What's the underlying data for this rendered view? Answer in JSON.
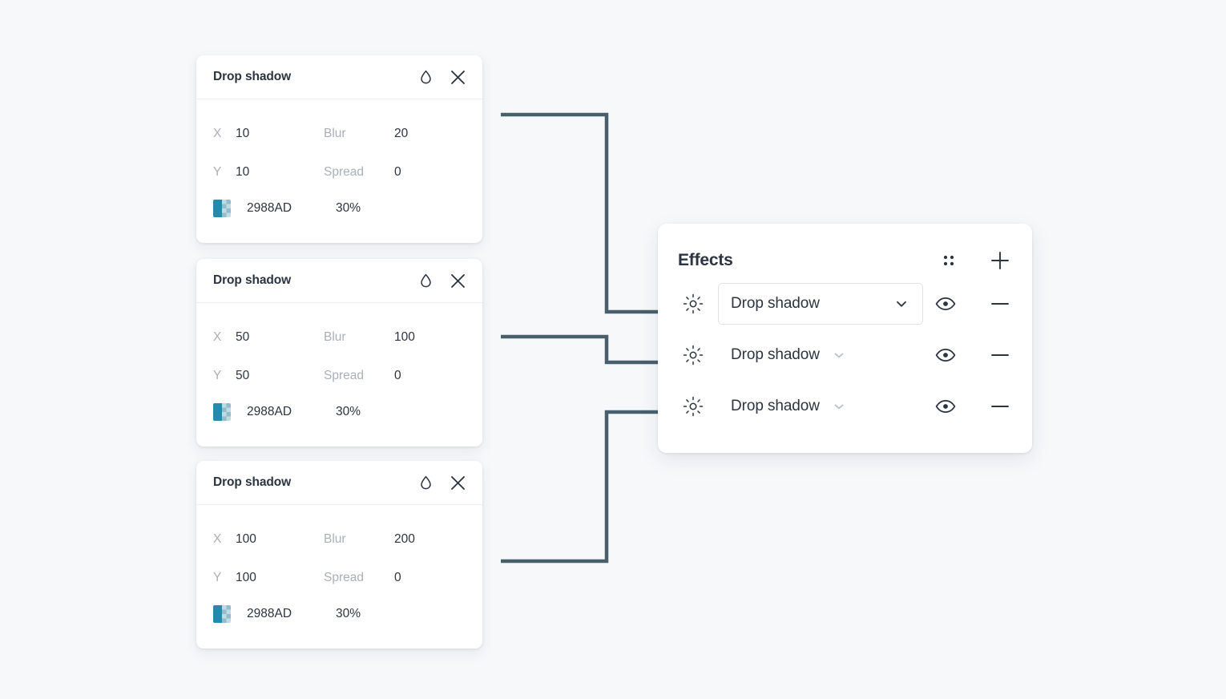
{
  "canvas": {
    "background_color": "#f6f8fa",
    "connector_color": "#47606c"
  },
  "shadow_cards": [
    {
      "title": "Drop shadow",
      "icons": {
        "droplet": "droplet-icon",
        "close": "close-icon"
      },
      "fields": {
        "x_label": "X",
        "x_value": "10",
        "y_label": "Y",
        "y_value": "10",
        "blur_label": "Blur",
        "blur_value": "20",
        "spread_label": "Spread",
        "spread_value": "0"
      },
      "color": {
        "hex": "2988AD",
        "swatch_color": "#2988AD",
        "opacity": "30%"
      }
    },
    {
      "title": "Drop shadow",
      "icons": {
        "droplet": "droplet-icon",
        "close": "close-icon"
      },
      "fields": {
        "x_label": "X",
        "x_value": "50",
        "y_label": "Y",
        "y_value": "50",
        "blur_label": "Blur",
        "blur_value": "100",
        "spread_label": "Spread",
        "spread_value": "0"
      },
      "color": {
        "hex": "2988AD",
        "swatch_color": "#2988AD",
        "opacity": "30%"
      }
    },
    {
      "title": "Drop shadow",
      "icons": {
        "droplet": "droplet-icon",
        "close": "close-icon"
      },
      "fields": {
        "x_label": "X",
        "x_value": "100",
        "y_label": "Y",
        "y_value": "100",
        "blur_label": "Blur",
        "blur_value": "200",
        "spread_label": "Spread",
        "spread_value": "0"
      },
      "color": {
        "hex": "2988AD",
        "swatch_color": "#2988AD",
        "opacity": "30%"
      }
    }
  ],
  "effects_panel": {
    "title": "Effects",
    "header_icons": {
      "drag_handle": "drag-handle-icon",
      "add": "plus-icon"
    },
    "rows": [
      {
        "effect_icon": "sun-icon",
        "label": "Drop shadow",
        "selected": true,
        "visibility_icon": "eye-icon",
        "remove_icon": "minus-icon"
      },
      {
        "effect_icon": "sun-icon",
        "label": "Drop shadow",
        "selected": false,
        "visibility_icon": "eye-icon",
        "remove_icon": "minus-icon"
      },
      {
        "effect_icon": "sun-icon",
        "label": "Drop shadow",
        "selected": false,
        "visibility_icon": "eye-icon",
        "remove_icon": "minus-icon"
      }
    ]
  }
}
